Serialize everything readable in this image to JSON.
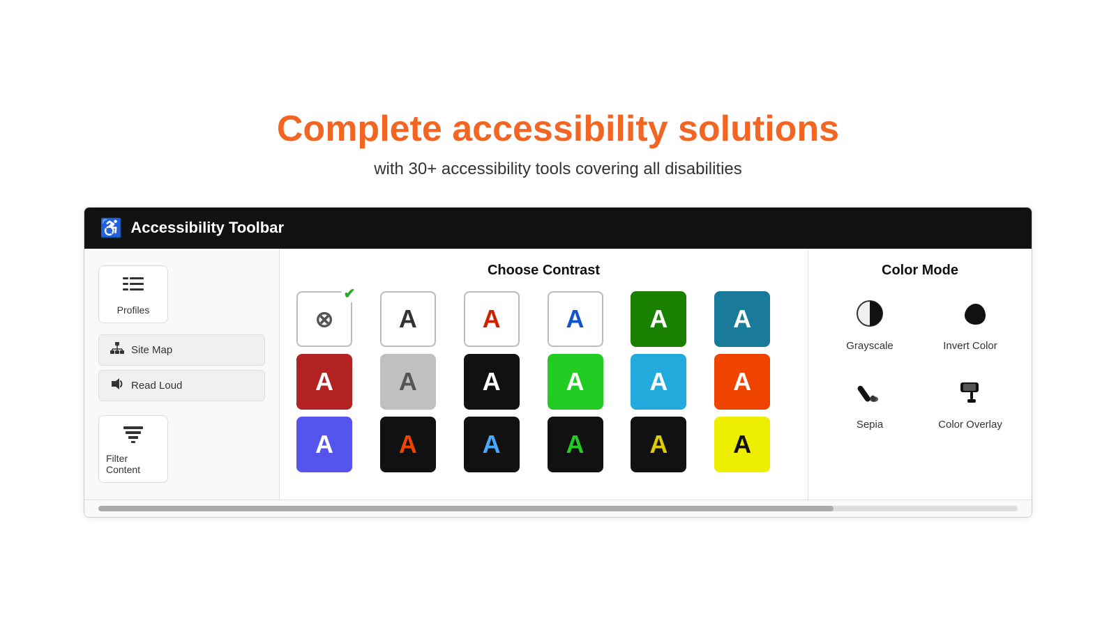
{
  "hero": {
    "title": "Complete accessibility solutions",
    "subtitle": "with 30+ accessibility tools covering all disabilities"
  },
  "toolbar": {
    "header_title": "Accessibility Toolbar",
    "left_panel": {
      "icon_items": [
        {
          "id": "profiles",
          "label": "Profiles"
        },
        {
          "id": "filter-content",
          "label": "Filter Content"
        }
      ],
      "menu_items": [
        {
          "id": "site-map",
          "label": "Site Map"
        },
        {
          "id": "read-loud",
          "label": "Read Loud"
        }
      ]
    },
    "choose_contrast": {
      "title": "Choose Contrast",
      "buttons": [
        {
          "id": "reset",
          "symbol": "⊗",
          "bg": "#fff",
          "color": "#333",
          "border": "#ccc",
          "checked": true
        },
        {
          "id": "default-a",
          "symbol": "A",
          "bg": "#fff",
          "color": "#333",
          "border": "#ccc"
        },
        {
          "id": "red-a",
          "symbol": "A",
          "bg": "#fff",
          "color": "#cc2200",
          "border": "#ccc"
        },
        {
          "id": "blue-a",
          "symbol": "A",
          "bg": "#fff",
          "color": "#1155cc",
          "border": "#ccc"
        },
        {
          "id": "green-bg",
          "symbol": "A",
          "bg": "#1a8000",
          "color": "#fff",
          "border": "transparent"
        },
        {
          "id": "teal-bg",
          "symbol": "A",
          "bg": "#1a7a9a",
          "color": "#fff",
          "border": "transparent"
        },
        {
          "id": "red-bg-white",
          "symbol": "A",
          "bg": "#b22222",
          "color": "#fff",
          "border": "transparent"
        },
        {
          "id": "gray-bg",
          "symbol": "A",
          "bg": "#bbbbbb",
          "color": "#555",
          "border": "transparent"
        },
        {
          "id": "black-bg-white",
          "symbol": "A",
          "bg": "#111",
          "color": "#fff",
          "border": "transparent"
        },
        {
          "id": "green-bg-white",
          "symbol": "A",
          "bg": "#22cc22",
          "color": "#fff",
          "border": "transparent"
        },
        {
          "id": "cyan-bg-white",
          "symbol": "A",
          "bg": "#22aadd",
          "color": "#fff",
          "border": "transparent"
        },
        {
          "id": "orange-bg-white",
          "symbol": "A",
          "bg": "#ee4400",
          "color": "#fff",
          "border": "transparent"
        },
        {
          "id": "blue-bg-white2",
          "symbol": "A",
          "bg": "#5555ee",
          "color": "#fff",
          "border": "transparent"
        },
        {
          "id": "black-bg-orange",
          "symbol": "A",
          "bg": "#111",
          "color": "#ee4400",
          "border": "transparent"
        },
        {
          "id": "black-bg-blue",
          "symbol": "A",
          "bg": "#111",
          "color": "#44aaff",
          "border": "transparent"
        },
        {
          "id": "black-bg-green",
          "symbol": "A",
          "bg": "#111",
          "color": "#22cc22",
          "border": "transparent"
        },
        {
          "id": "black-bg-yellow2",
          "symbol": "A",
          "bg": "#111",
          "color": "#ddcc00",
          "border": "transparent"
        },
        {
          "id": "yellow-bg-black",
          "symbol": "A",
          "bg": "#eedd00",
          "color": "#111",
          "border": "transparent"
        }
      ]
    },
    "color_mode": {
      "title": "Color Mode",
      "items": [
        {
          "id": "grayscale",
          "label": "Grayscale",
          "icon": "half-circle"
        },
        {
          "id": "invert-color",
          "label": "Invert Color",
          "icon": "moon"
        },
        {
          "id": "sepia",
          "label": "Sepia",
          "icon": "brush"
        },
        {
          "id": "color-overlay",
          "label": "Color Overlay",
          "icon": "paint-roller"
        }
      ]
    }
  }
}
